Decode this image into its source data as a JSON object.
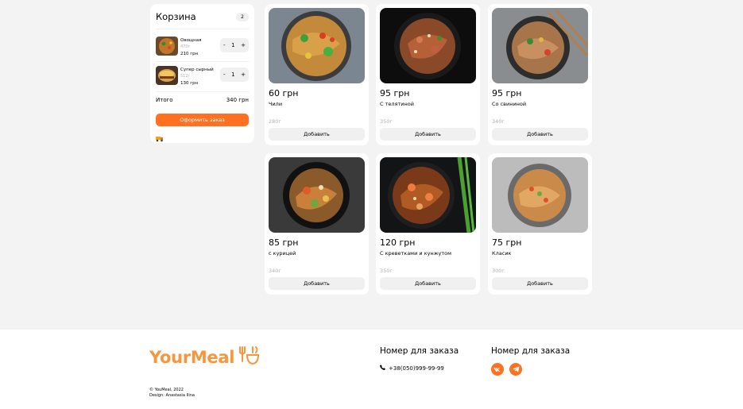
{
  "cart": {
    "title": "Корзина",
    "count": "2",
    "items": [
      {
        "name": "Овощная",
        "weight": "470г",
        "price": "210 грн",
        "qty": "1",
        "minus": "-",
        "plus": "+"
      },
      {
        "name": "Супер сырный",
        "weight": "512г",
        "price": "130 грн",
        "qty": "1",
        "minus": "-",
        "plus": "+"
      }
    ],
    "total_label": "Итого",
    "total_value": "340 грн",
    "order_button": "Оформить заказ"
  },
  "products": [
    {
      "price": "60 грн",
      "title": "Чили",
      "weight": "280г",
      "add": "Добавить"
    },
    {
      "price": "95 грн",
      "title": "С телятиной",
      "weight": "350г",
      "add": "Добавить"
    },
    {
      "price": "95 грн",
      "title": "Со свининой",
      "weight": "340г",
      "add": "Добавить"
    },
    {
      "price": "85 грн",
      "title": "с курицей",
      "weight": "340г",
      "add": "Добавить"
    },
    {
      "price": "120 грн",
      "title": "С креветками и кунжутом",
      "weight": "350г",
      "add": "Добавить"
    },
    {
      "price": "75 грн",
      "title": "Класик",
      "weight": "300г",
      "add": "Добавить"
    }
  ],
  "footer": {
    "logo": "YourMeal",
    "copyright": "© YouMeal, 2022",
    "design": "Design: Anastasia Ilina",
    "col1_title": "Номер для заказа",
    "phone": "+38(050)999-99-99",
    "col2_title": "Номер для заказа"
  },
  "colors": {
    "accent": "#ff7020",
    "logo": "#f7963c",
    "background": "#f3f3f3"
  }
}
